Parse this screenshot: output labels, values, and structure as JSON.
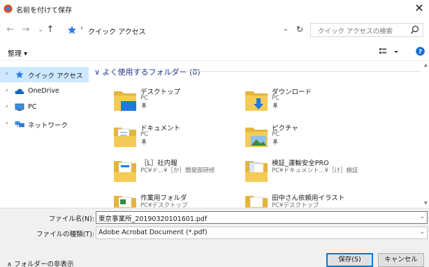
{
  "window": {
    "title": "名前を付けて保存",
    "close_glyph": "✕"
  },
  "nav": {
    "back_glyph": "←",
    "forward_glyph": "→",
    "recent_glyph": "⌄",
    "up_glyph": "↑",
    "address_sep": "›",
    "address": "クイック アクセス",
    "address_dropdown_glyph": "⌄",
    "refresh_glyph": "↻",
    "search_placeholder": "クイック アクセスの検索"
  },
  "toolbar": {
    "organize": "整理 ▾"
  },
  "sidebar": {
    "items": [
      {
        "label": "クイック アクセス",
        "icon": "star-icon",
        "chevron": "›",
        "selected": true
      },
      {
        "label": "OneDrive",
        "icon": "cloud-icon",
        "chevron": "›",
        "selected": false
      },
      {
        "label": "PC",
        "icon": "pc-icon",
        "chevron": "›",
        "selected": false
      },
      {
        "label": "ネットワーク",
        "icon": "network-icon",
        "chevron": "›",
        "selected": false
      }
    ]
  },
  "content": {
    "group_header": "∨ よく使用するフォルダー (8)",
    "folders": [
      {
        "name": "デスクトップ",
        "sub": "PC",
        "pinned": true,
        "icon": "desktop-folder-icon"
      },
      {
        "name": "ダウンロード",
        "sub": "PC",
        "pinned": true,
        "icon": "downloads-folder-icon"
      },
      {
        "name": "ドキュメント",
        "sub": "PC",
        "pinned": true,
        "icon": "documents-folder-icon"
      },
      {
        "name": "ピクチャ",
        "sub": "PC",
        "pinned": true,
        "icon": "pictures-folder-icon"
      },
      {
        "name": "［L］社内報",
        "sub": "PC¥ド...¥［か］開発部研修",
        "pinned": false,
        "icon": "document-folder-icon"
      },
      {
        "name": "検証_運輸安全PRO",
        "sub": "PC¥ドキュメント...¥［け］検証",
        "pinned": false,
        "icon": "document-folder-icon"
      },
      {
        "name": "作業用フォルダ",
        "sub": "PC¥デスクトップ",
        "pinned": false,
        "icon": "spreadsheet-folder-icon"
      },
      {
        "name": "田中さん依頼用イラスト",
        "sub": "PC¥デスクトップ",
        "pinned": false,
        "icon": "document-folder-icon"
      }
    ]
  },
  "bottom": {
    "filename_label": "ファイル名(N):",
    "filename_value": "東京事業所_20190320101601.pdf",
    "filetype_label": "ファイルの種類(T):",
    "filetype_value": "Adobe Acrobat Document (*.pdf)",
    "dropdown_glyph": "⌄",
    "hide_folders": "∧ フォルダーの非表示",
    "save_button": "保存(S)",
    "cancel_button": "キャンセル"
  },
  "colors": {
    "accent": "#0078d7",
    "selected_bg": "#cde8ff",
    "folder_yellow": "#f0c24a",
    "group_header": "#1e3287"
  }
}
